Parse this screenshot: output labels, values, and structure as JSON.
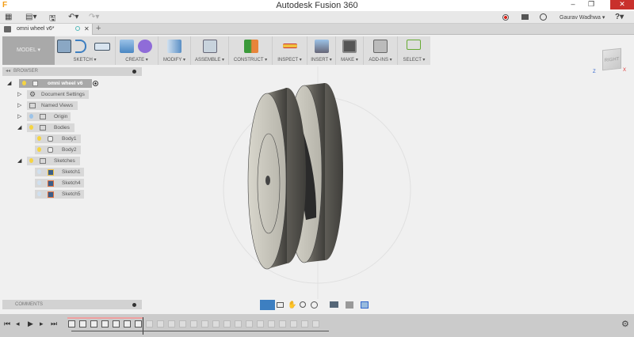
{
  "window": {
    "title": "Autodesk Fusion 360",
    "minimize": "–",
    "restore": "❐",
    "close": "✕"
  },
  "qat": {
    "apps": "▦",
    "file": "▤▾",
    "save": "🖫",
    "undo": "↶▾",
    "redo": "↷▾"
  },
  "user": {
    "name": "Gaurav Wadhwa ▾",
    "help": "?▾"
  },
  "doc_tab": {
    "label": "omni wheel v6*",
    "close": "✕",
    "new_tab": "+"
  },
  "ribbon": {
    "workspace": "MODEL ▾",
    "groups": [
      {
        "label": "SKETCH ▾"
      },
      {
        "label": "CREATE ▾"
      },
      {
        "label": "MODIFY ▾"
      },
      {
        "label": "ASSEMBLE ▾"
      },
      {
        "label": "CONSTRUCT ▾"
      },
      {
        "label": "INSPECT ▾"
      },
      {
        "label": "INSERT ▾"
      },
      {
        "label": "MAKE ▾"
      },
      {
        "label": "ADD-INS ▾"
      },
      {
        "label": "SELECT ▾"
      }
    ]
  },
  "viewcube": {
    "face": "RIGHT",
    "z": "Z",
    "x": "X"
  },
  "browser": {
    "title": "BROWSER",
    "root": "omni wheel v6",
    "items": [
      {
        "label": "Document Settings"
      },
      {
        "label": "Named Views"
      },
      {
        "label": "Origin"
      },
      {
        "label": "Bodies"
      },
      {
        "label": "Body1"
      },
      {
        "label": "Body2"
      },
      {
        "label": "Sketches"
      },
      {
        "label": "Sketch1"
      },
      {
        "label": "Sketch4"
      },
      {
        "label": "Sketch5"
      }
    ]
  },
  "comments": {
    "title": "COMMENTS"
  },
  "colors": {
    "accent": "#3d7fc1",
    "close": "#c9302c",
    "record": "#d9261c"
  }
}
